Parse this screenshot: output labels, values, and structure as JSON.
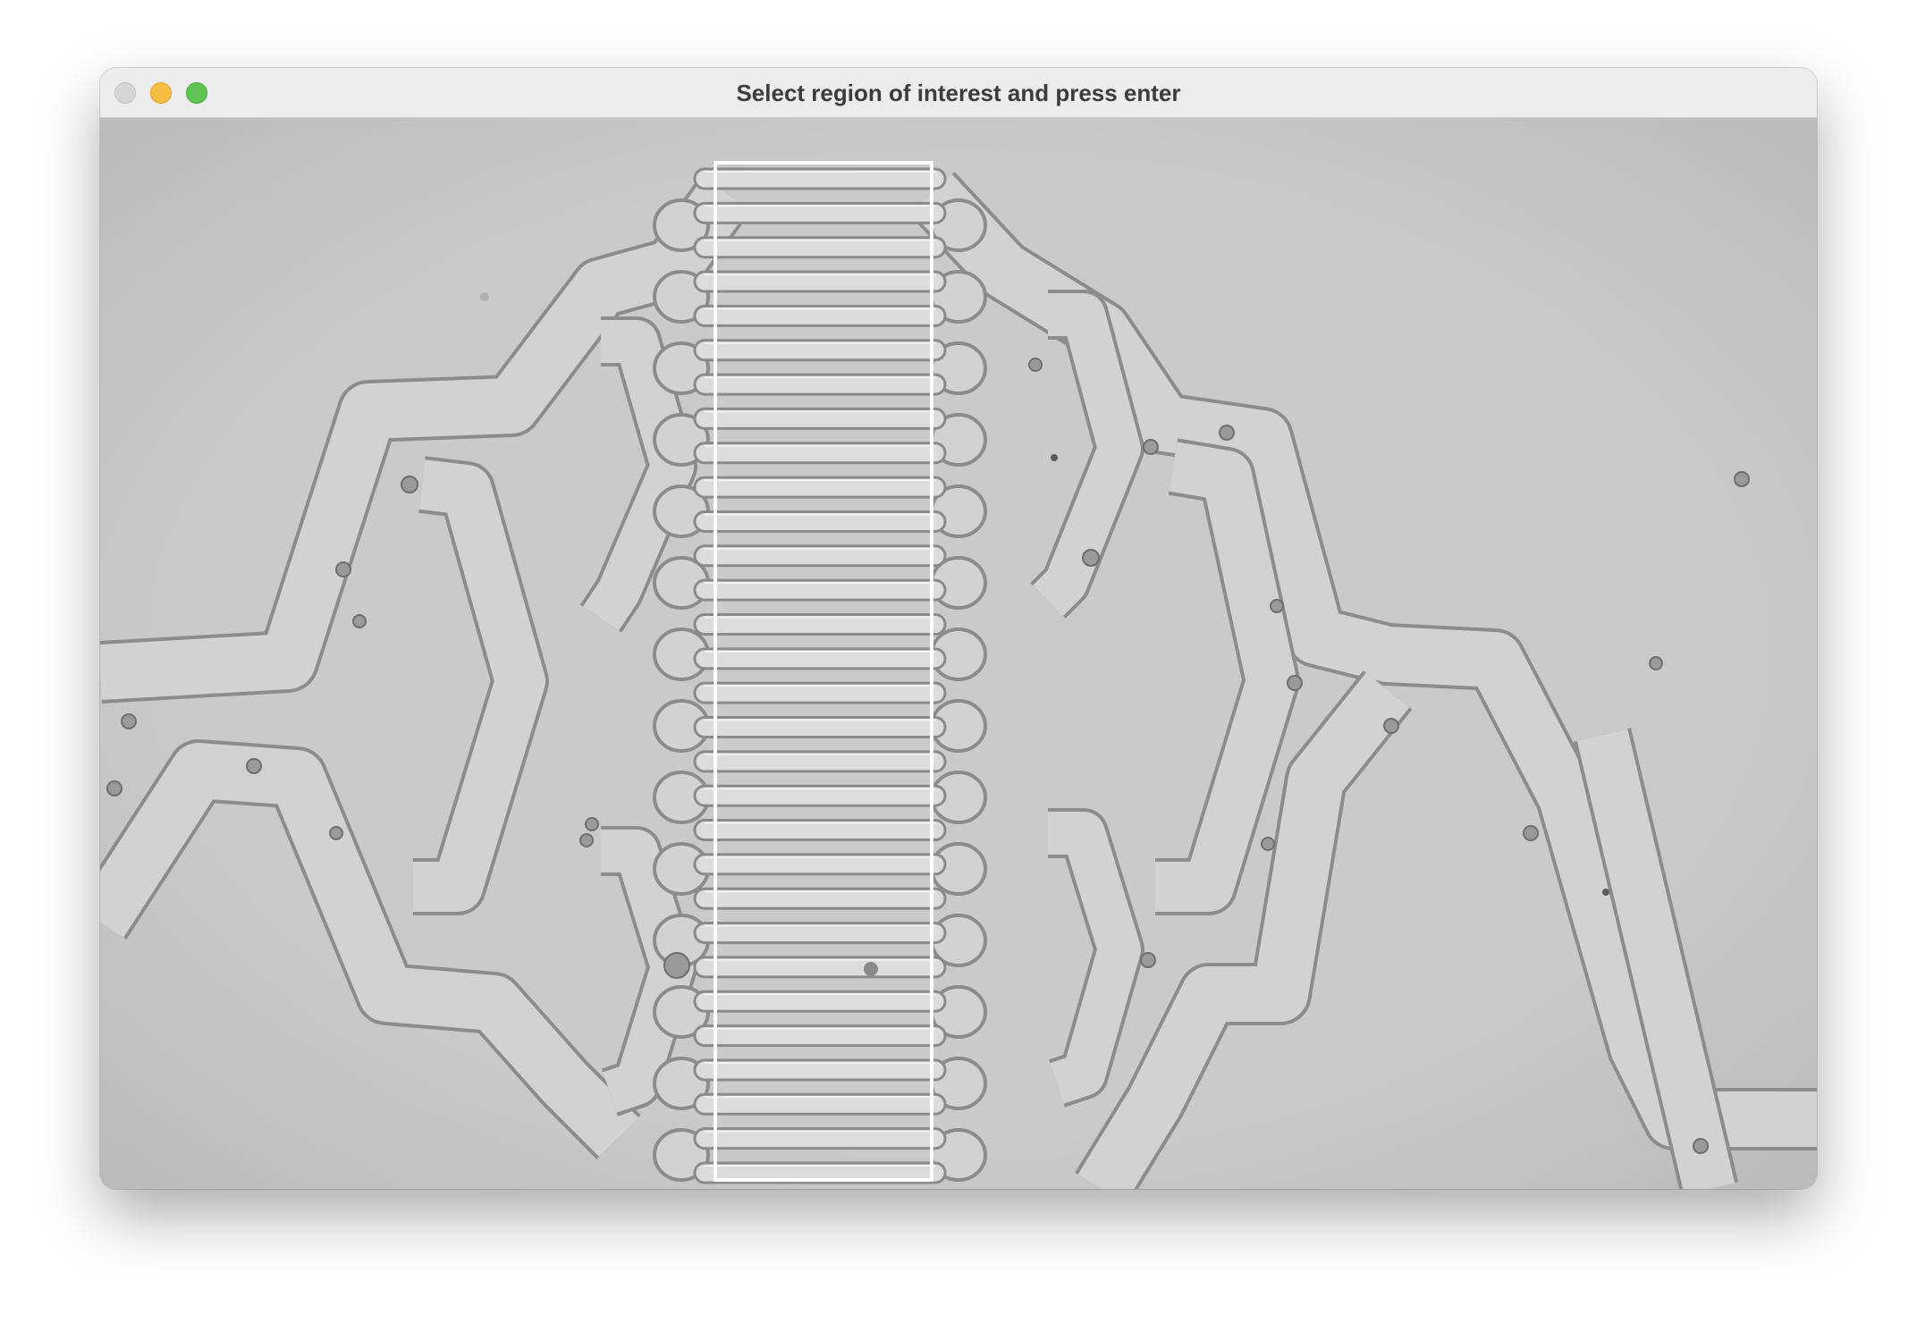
{
  "window": {
    "title": "Select region of interest and press enter",
    "controls": {
      "close": "close-icon",
      "minimize": "minimize-icon",
      "zoom": "zoom-icon"
    }
  },
  "image": {
    "description_icon": "microscope-image",
    "background_color": "#c8c8c8",
    "channel_wall_color": "#e8e8e8",
    "channel_shadow_color": "#8a8a8a"
  },
  "roi": {
    "border_color": "#ffffff",
    "channel_count": 30
  }
}
